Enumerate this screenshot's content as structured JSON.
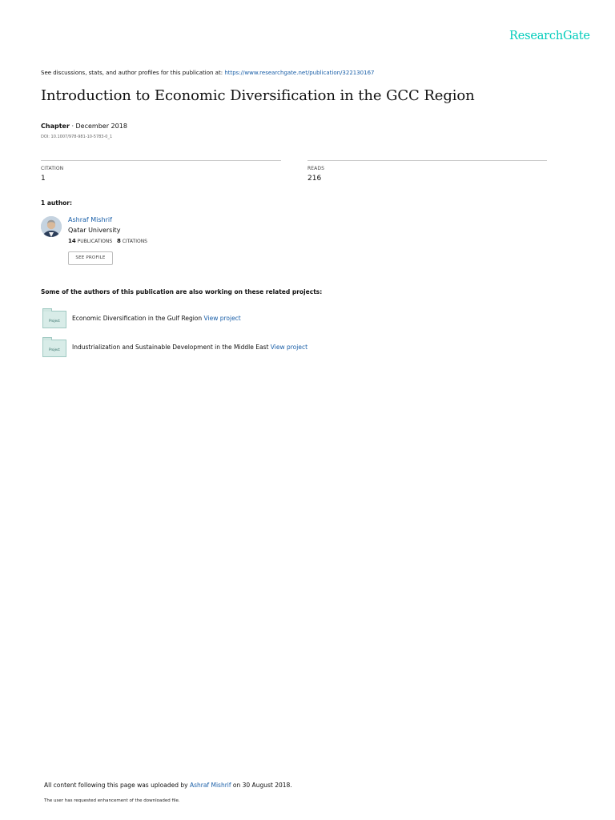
{
  "header": {
    "logo": "ResearchGate"
  },
  "discussion": {
    "prefix": "See discussions, stats, and author profiles for this publication at:",
    "url": "https://www.researchgate.net/publication/322130167"
  },
  "publication": {
    "title": "Introduction to Economic Diversification in the GCC Region",
    "type": "Chapter",
    "date": "· December 2018",
    "doi": "DOI: 10.1007/978-981-10-5783-0_1"
  },
  "stats": {
    "citation_label": "CITATION",
    "citation_value": "1",
    "reads_label": "READS",
    "reads_value": "216"
  },
  "authors": {
    "heading": "1 author:",
    "list": [
      {
        "name": "Ashraf Mishrif",
        "affiliation": "Qatar University",
        "publications_count": "14",
        "publications_label": "PUBLICATIONS",
        "citations_count": "8",
        "citations_label": "CITATIONS",
        "button_label": "SEE PROFILE"
      }
    ]
  },
  "related": {
    "heading": "Some of the authors of this publication are also working on these related projects:",
    "icon_label": "Project",
    "projects": [
      {
        "title": "Economic Diversification in the Gulf Region",
        "link": "View project"
      },
      {
        "title": "Industrialization and Sustainable Development in the Middle East",
        "link": "View project"
      }
    ]
  },
  "footer": {
    "prefix": "All content following this page was uploaded by",
    "uploader": "Ashraf Mishrif",
    "suffix": "on 30 August 2018.",
    "note": "The user has requested enhancement of the downloaded file."
  },
  "colors": {
    "brand": "#00ccbb",
    "link": "#1a5fa8",
    "text": "#111111",
    "project_icon": "#d8ece8"
  }
}
